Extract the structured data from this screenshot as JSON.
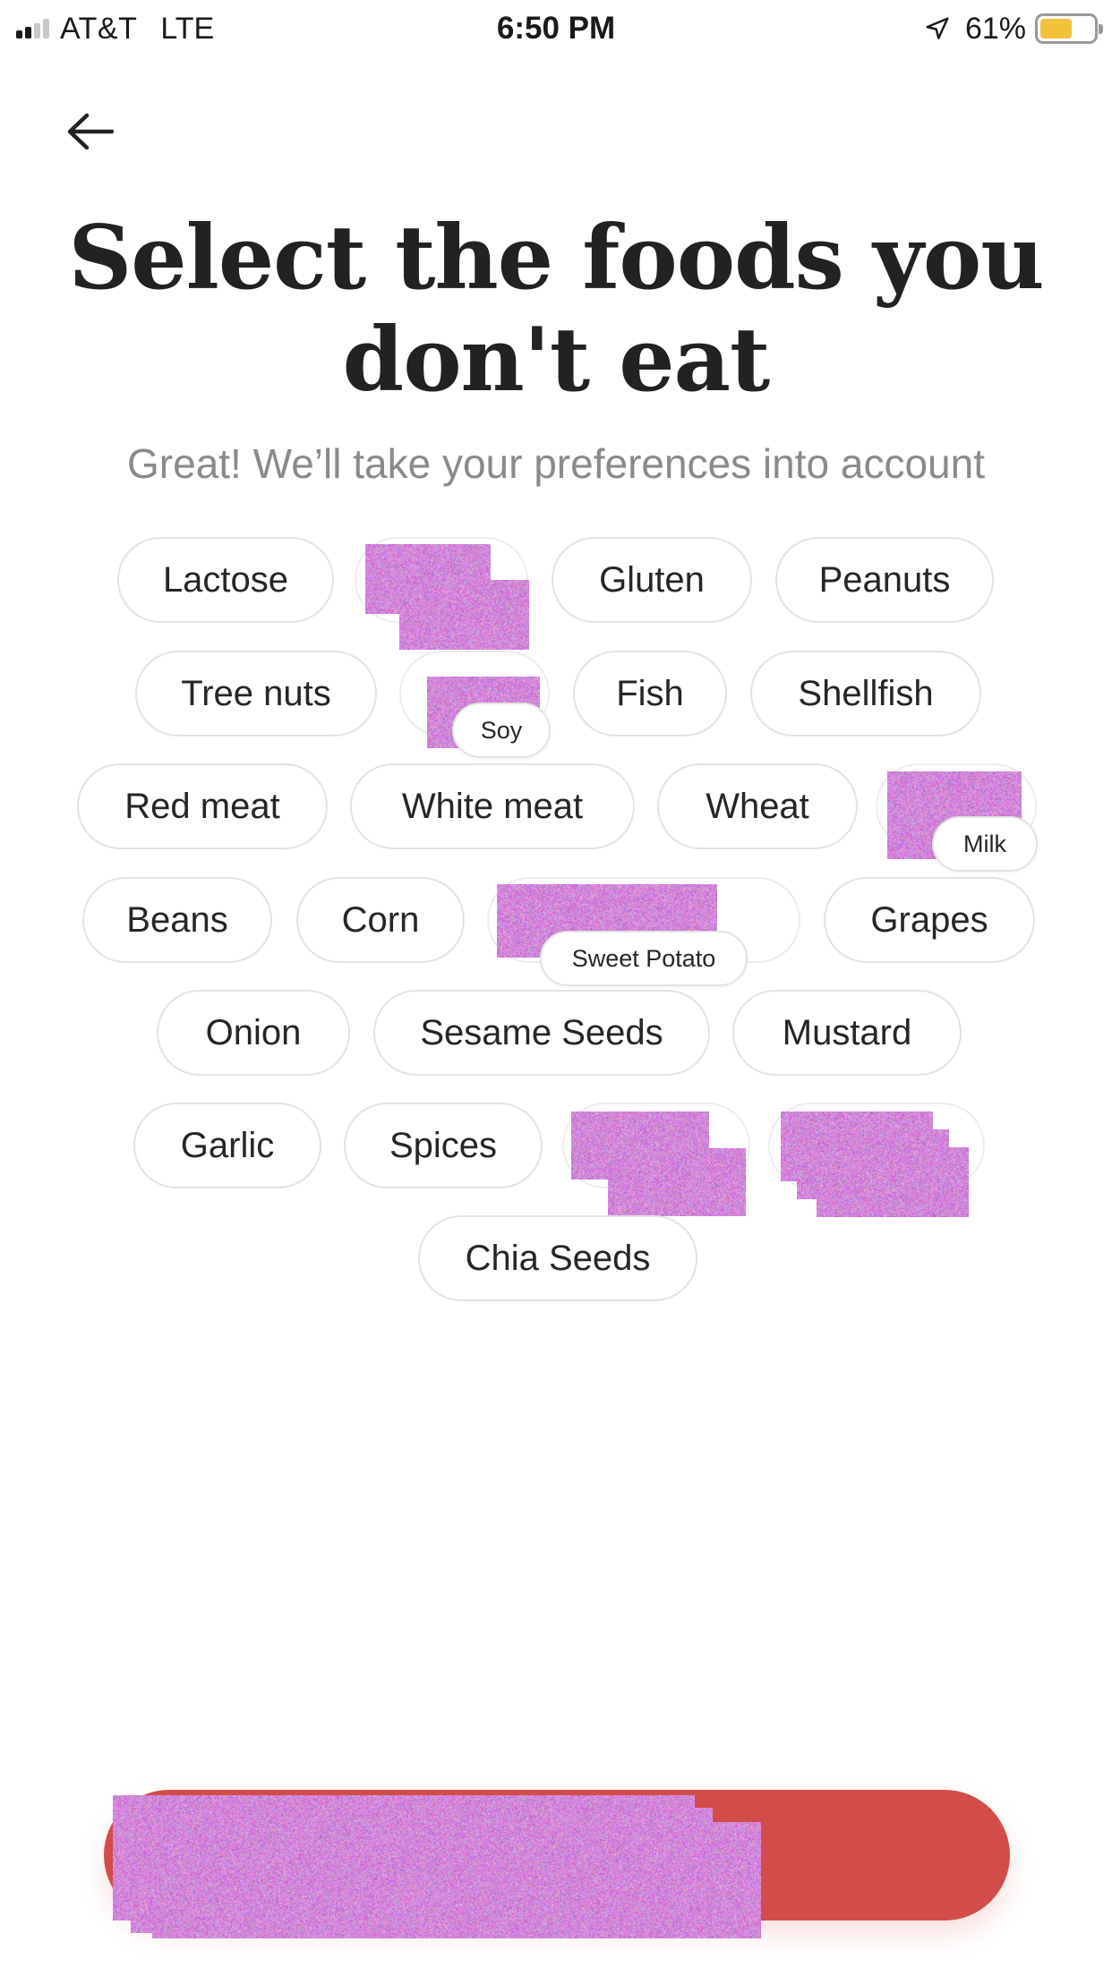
{
  "status_bar": {
    "carrier": "AT&T",
    "network": "LTE",
    "time": "6:50 PM",
    "battery_percent": "61%",
    "battery_level": 0.61,
    "signal_bars_on": 2,
    "signal_bars_total": 4,
    "location_icon": "location-arrow-icon"
  },
  "header": {
    "back_icon": "arrow-left-icon",
    "title": "Select the foods you don't eat",
    "subtitle": "Great! We’ll take your preferences into account"
  },
  "foods": {
    "lactose": "Lactose",
    "gluten": "Gluten",
    "peanuts": "Peanuts",
    "tree_nuts": "Tree nuts",
    "soy": "Soy",
    "fish": "Fish",
    "shellfish": "Shellfish",
    "red_meat": "Red meat",
    "white_meat": "White meat",
    "wheat": "Wheat",
    "milk": "Milk",
    "beans": "Beans",
    "corn": "Corn",
    "sweet_potato": "Sweet Potato",
    "grapes": "Grapes",
    "onion": "Onion",
    "sesame_seeds": "Sesame Seeds",
    "mustard": "Mustard",
    "garlic": "Garlic",
    "spices": "Spices",
    "chia_seeds": "Chia Seeds"
  },
  "colors": {
    "accent": "#d24d49",
    "chip_border": "#e3e3e3",
    "battery": "#f2c23b",
    "subtitle": "#8a8a8a",
    "redaction": "#c77fcc"
  }
}
